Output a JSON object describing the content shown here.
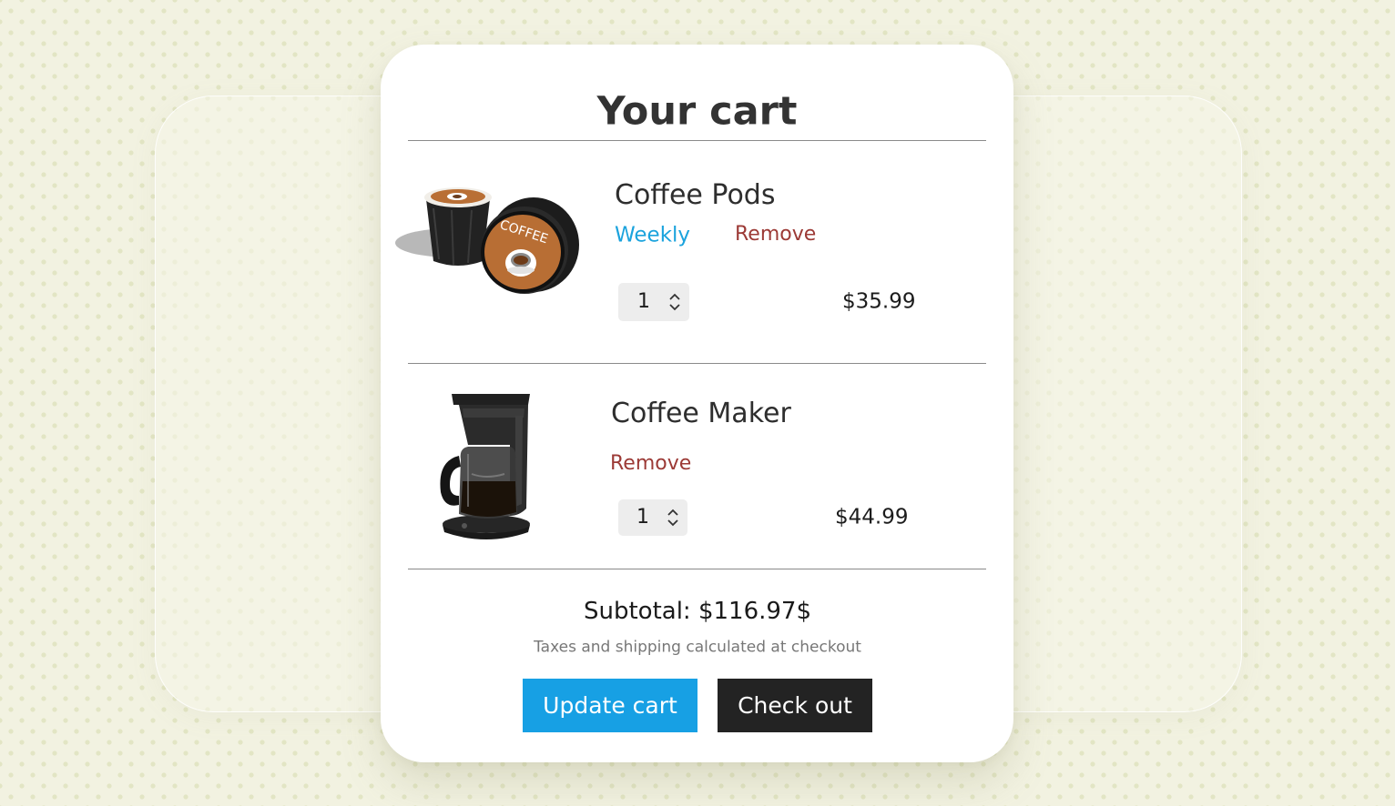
{
  "cart": {
    "title": "Your cart",
    "items": [
      {
        "name": "Coffee Pods",
        "frequency": "Weekly",
        "remove_label": "Remove",
        "quantity": "1",
        "price": "$35.99",
        "image_icon": "coffee-pods-image",
        "pod_label": "COFFEE"
      },
      {
        "name": "Coffee Maker",
        "remove_label": "Remove",
        "quantity": "1",
        "price": "$44.99",
        "image_icon": "coffee-maker-image"
      }
    ],
    "subtotal": "Subtotal: $116.97$",
    "tax_note": "Taxes and shipping calculated at checkout",
    "update_label": "Update cart",
    "checkout_label": "Check out"
  },
  "colors": {
    "background": "#f2f2e1",
    "link_blue": "#1ba3dd",
    "remove_red": "#9c3a36",
    "update_button": "#17a0e4",
    "checkout_button": "#232323"
  }
}
